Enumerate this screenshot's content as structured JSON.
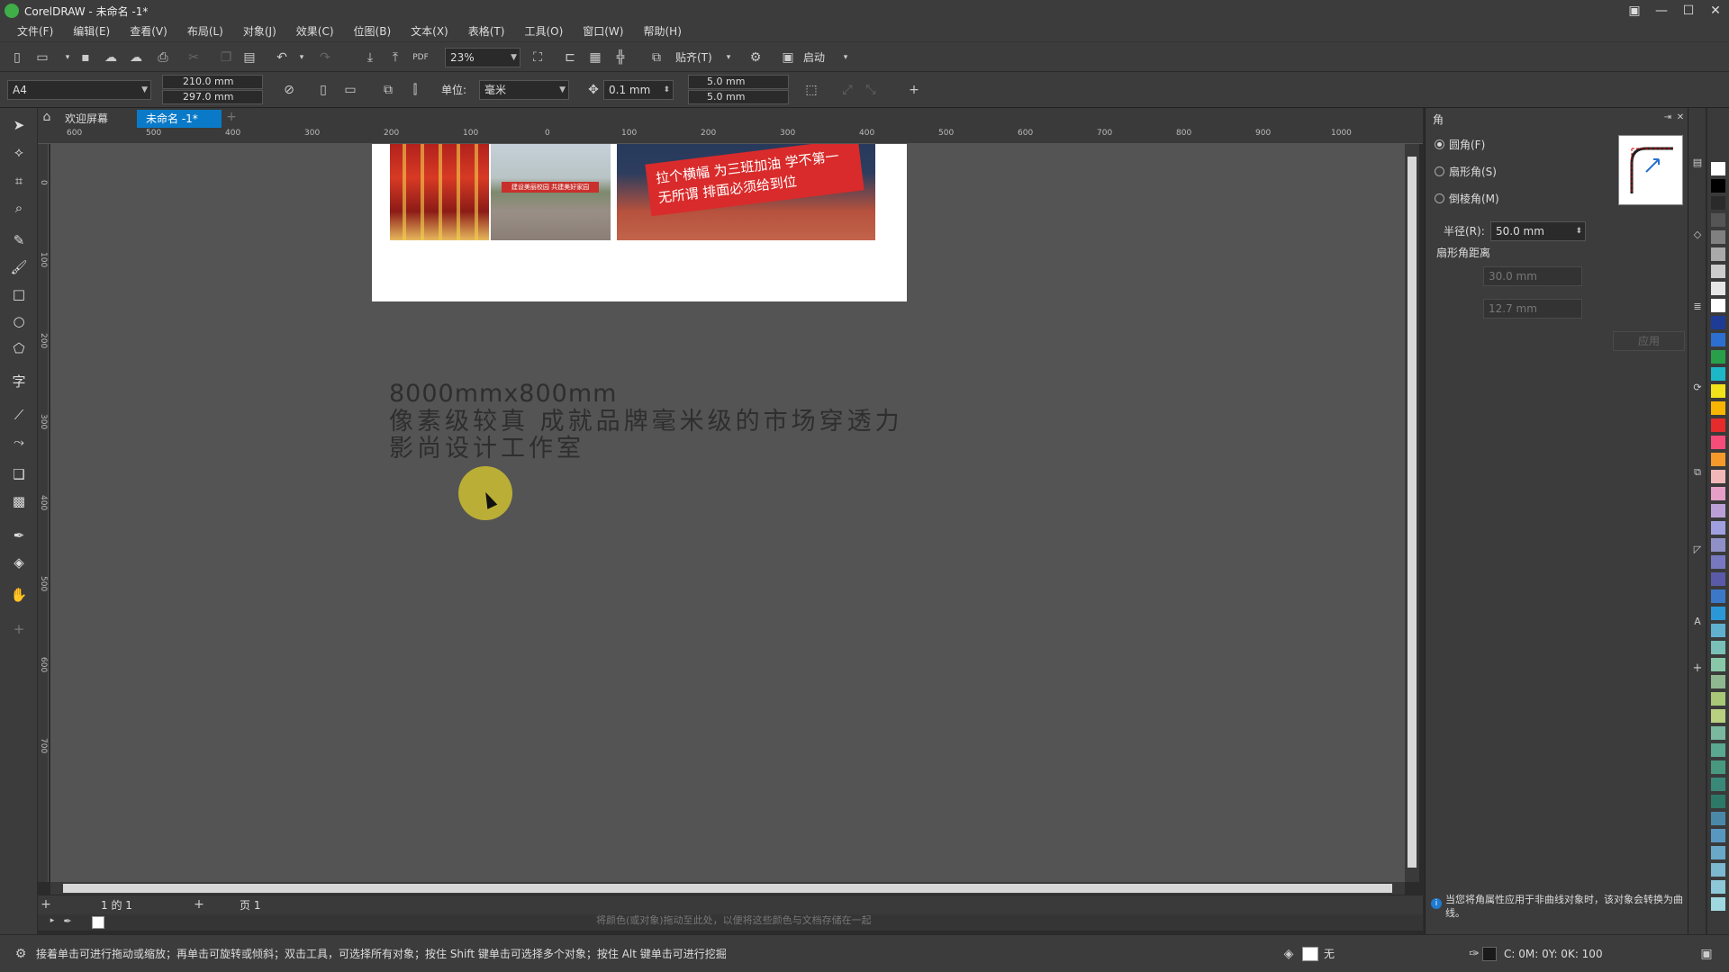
{
  "window": {
    "title": "CorelDRAW - 未命名 -1*",
    "controls": [
      "restore-icon",
      "minimize-icon",
      "maximize-icon",
      "close-icon"
    ]
  },
  "menu": [
    "文件(F)",
    "编辑(E)",
    "查看(V)",
    "布局(L)",
    "对象(J)",
    "效果(C)",
    "位图(B)",
    "文本(X)",
    "表格(T)",
    "工具(O)",
    "窗口(W)",
    "帮助(H)"
  ],
  "toolbar1": {
    "zoom": "23%",
    "snap_label": "贴齐(T)",
    "launch_label": "启动"
  },
  "toolbar2": {
    "page_size": "A4",
    "width": "210.0 mm",
    "height": "297.0 mm",
    "unit_label": "单位:",
    "unit_value": "毫米",
    "nudge": "0.1 mm",
    "dup_x": "5.0 mm",
    "dup_y": "5.0 mm"
  },
  "tabs": {
    "welcome": "欢迎屏幕",
    "document": "未命名 -1*"
  },
  "hruler_labels": [
    "600",
    "500",
    "400",
    "300",
    "200",
    "100",
    "0",
    "100",
    "200",
    "300",
    "400",
    "500",
    "600",
    "700",
    "800",
    "900",
    "1000"
  ],
  "vruler_labels": [
    "0",
    "100",
    "200",
    "300",
    "400",
    "500",
    "600",
    "700"
  ],
  "canvas": {
    "photo3_banner": "拉个横幅 为三班加油 学不第一无所谓 排面必须给到位",
    "photo2_banner": "建设美丽校园 共建美好家园",
    "text_line1": "8000mmx800mm",
    "text_line2": "像素级较真 成就品牌毫米级的市场穿透力",
    "text_line3": "影尚设计工作室"
  },
  "pagenav": {
    "counter": "1 的 1",
    "page_tab": "页 1"
  },
  "color_hint": "将颜色(或对象)拖动至此处，以便将这些颜色与文档存储在一起",
  "status": {
    "hint": "接着单击可进行拖动或缩放；再单击可旋转或倾斜；双击工具，可选择所有对象；按住 Shift 键单击可选择多个对象；按住 Alt 键单击可进行挖掘",
    "fill_label": "无",
    "color_values": "C: 0M: 0Y: 0K: 100"
  },
  "right_panel": {
    "title": "角",
    "option_round": "圆角(F)",
    "option_scallop": "扇形角(S)",
    "option_chamfer": "倒棱角(M)",
    "radius_label": "半径(R):",
    "radius_value": "50.0 mm",
    "scallop_dist_label": "扇形角距离",
    "dist1_value": "30.0 mm",
    "dist2_value": "12.7 mm",
    "apply_label": "应用",
    "info_text": "当您将角属性应用于非曲线对象时，该对象会转换为曲线。"
  },
  "palette_colors": [
    "#ffffff",
    "#000000",
    "#2a2a2a",
    "#555555",
    "#808080",
    "#aaaaaa",
    "#cccccc",
    "#e6e6e6",
    "#ffffff",
    "#1e3c96",
    "#2d6fd0",
    "#28a04a",
    "#1db8c8",
    "#f2e21a",
    "#f7b500",
    "#e52b2b",
    "#f54c7a",
    "#f59a2a",
    "#f2b8b8",
    "#e6a0c8",
    "#bba0d8",
    "#a0a0e0",
    "#9090c8",
    "#7878c0",
    "#5a5aa8",
    "#3c78c8",
    "#2a98d8",
    "#60b0d0",
    "#78c0b8",
    "#88c8a8",
    "#90b890",
    "#a8c878",
    "#b8d080",
    "#7ab8a0",
    "#5aa890",
    "#489880",
    "#3a8878",
    "#2e7868",
    "#4a88a8",
    "#5898c0",
    "#6aa8c8",
    "#7cb8d0",
    "#8ec8d8",
    "#a0d8e0"
  ]
}
